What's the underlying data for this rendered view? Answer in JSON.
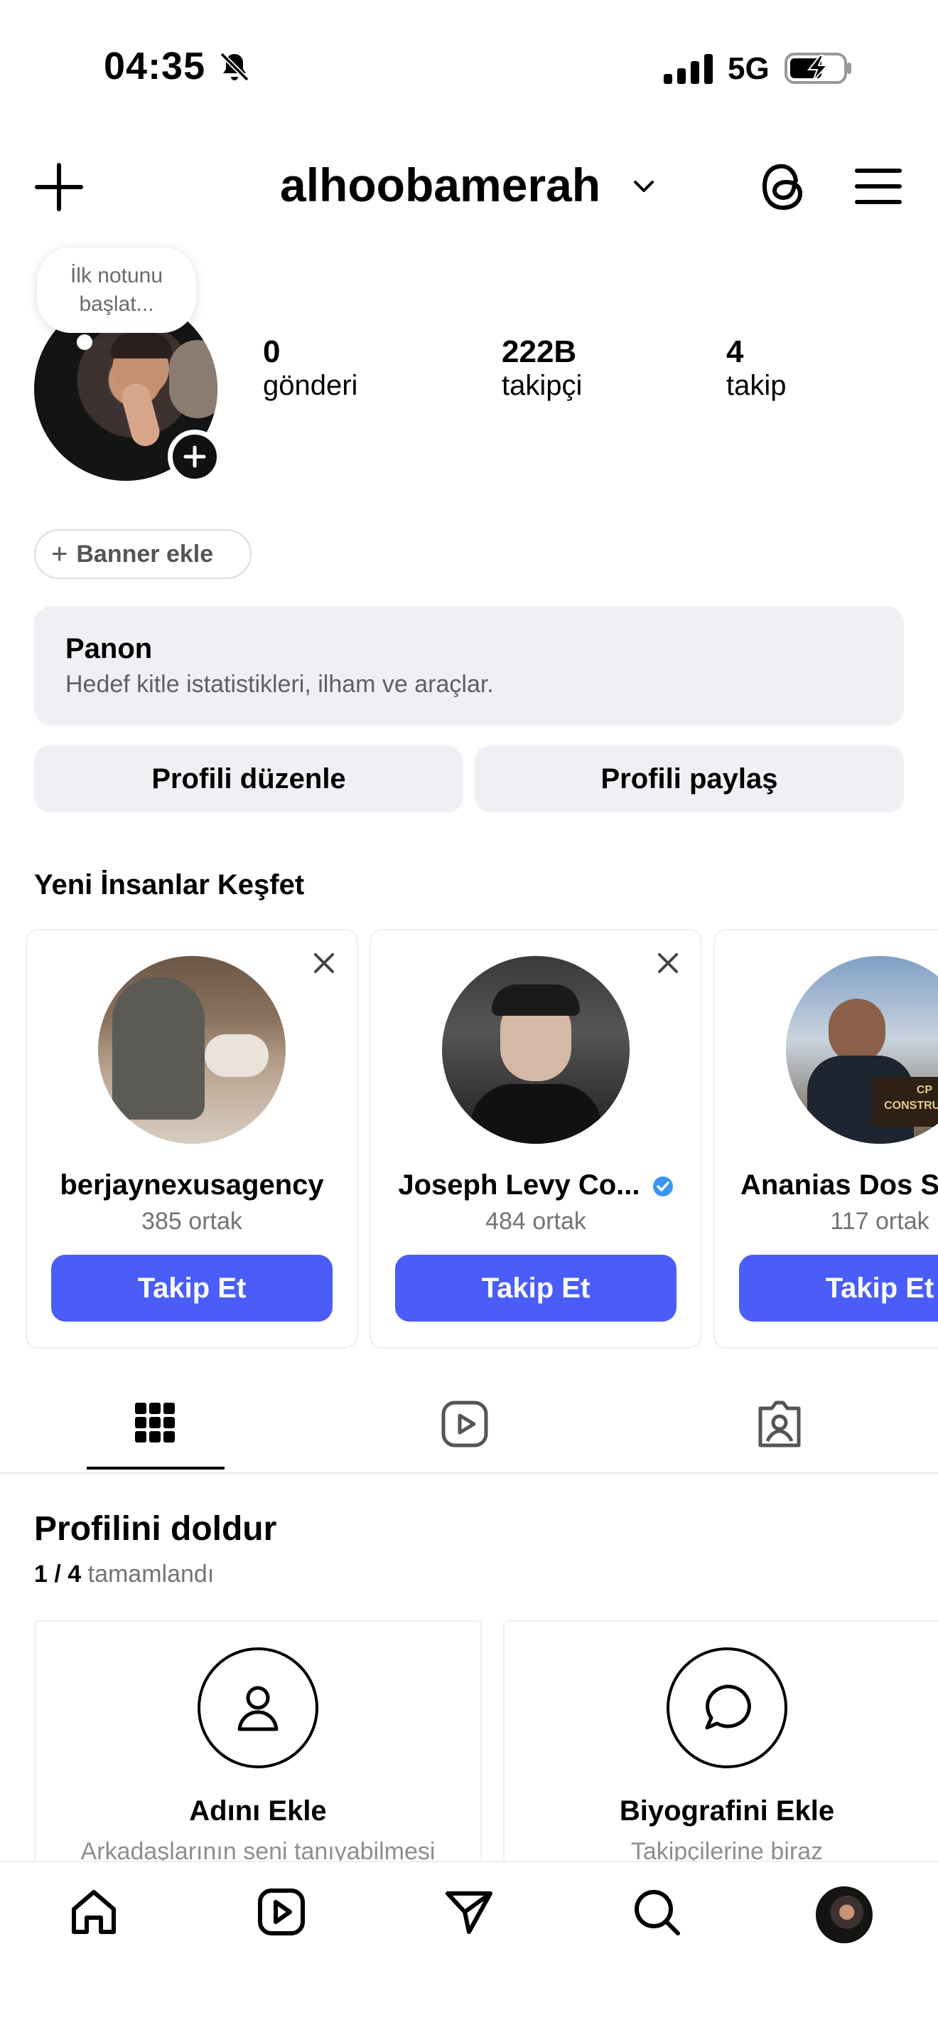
{
  "status_bar": {
    "time": "04:35",
    "network": "5G"
  },
  "header": {
    "username": "alhoobamerah"
  },
  "profile": {
    "note_line1": "İlk notunu",
    "note_line2": "başlat...",
    "stats": [
      {
        "value": "0",
        "label": "gönderi"
      },
      {
        "value": "222B",
        "label": "takipçi"
      },
      {
        "value": "4",
        "label": "takip"
      }
    ],
    "banner_label": "Banner ekle"
  },
  "dashboard": {
    "title": "Panon",
    "subtitle": "Hedef kitle istatistikleri, ilham ve araçlar."
  },
  "actions": {
    "edit_profile": "Profili düzenle",
    "share_profile": "Profili paylaş"
  },
  "discover": {
    "title": "Yeni İnsanlar Keşfet",
    "follow_label": "Takip Et",
    "cards": [
      {
        "name": "berjaynexusagency",
        "mutual": "385 ortak"
      },
      {
        "name": "Joseph Levy Co...",
        "mutual": "484 ortak",
        "verified": true
      },
      {
        "name": "Ananias Dos S",
        "mutual": "117 ortak"
      }
    ],
    "card3_logo_top": "CP",
    "card3_logo_text": "CONSTRUÇÕE"
  },
  "complete_profile": {
    "title": "Profilini doldur",
    "progress": "1 / 4",
    "progress_suffix": "tamamlandı",
    "cards": [
      {
        "title": "Adını Ekle",
        "desc": "Arkadaşlarının seni tanıyabilmesi",
        "icon": "person-icon"
      },
      {
        "title": "Biyografini Ekle",
        "desc": "Takipçilerine biraz",
        "icon": "speech-bubble-icon"
      }
    ]
  },
  "colors": {
    "accent": "#4a5df9",
    "verified": "#3897f0",
    "surface": "#eff0f3"
  }
}
